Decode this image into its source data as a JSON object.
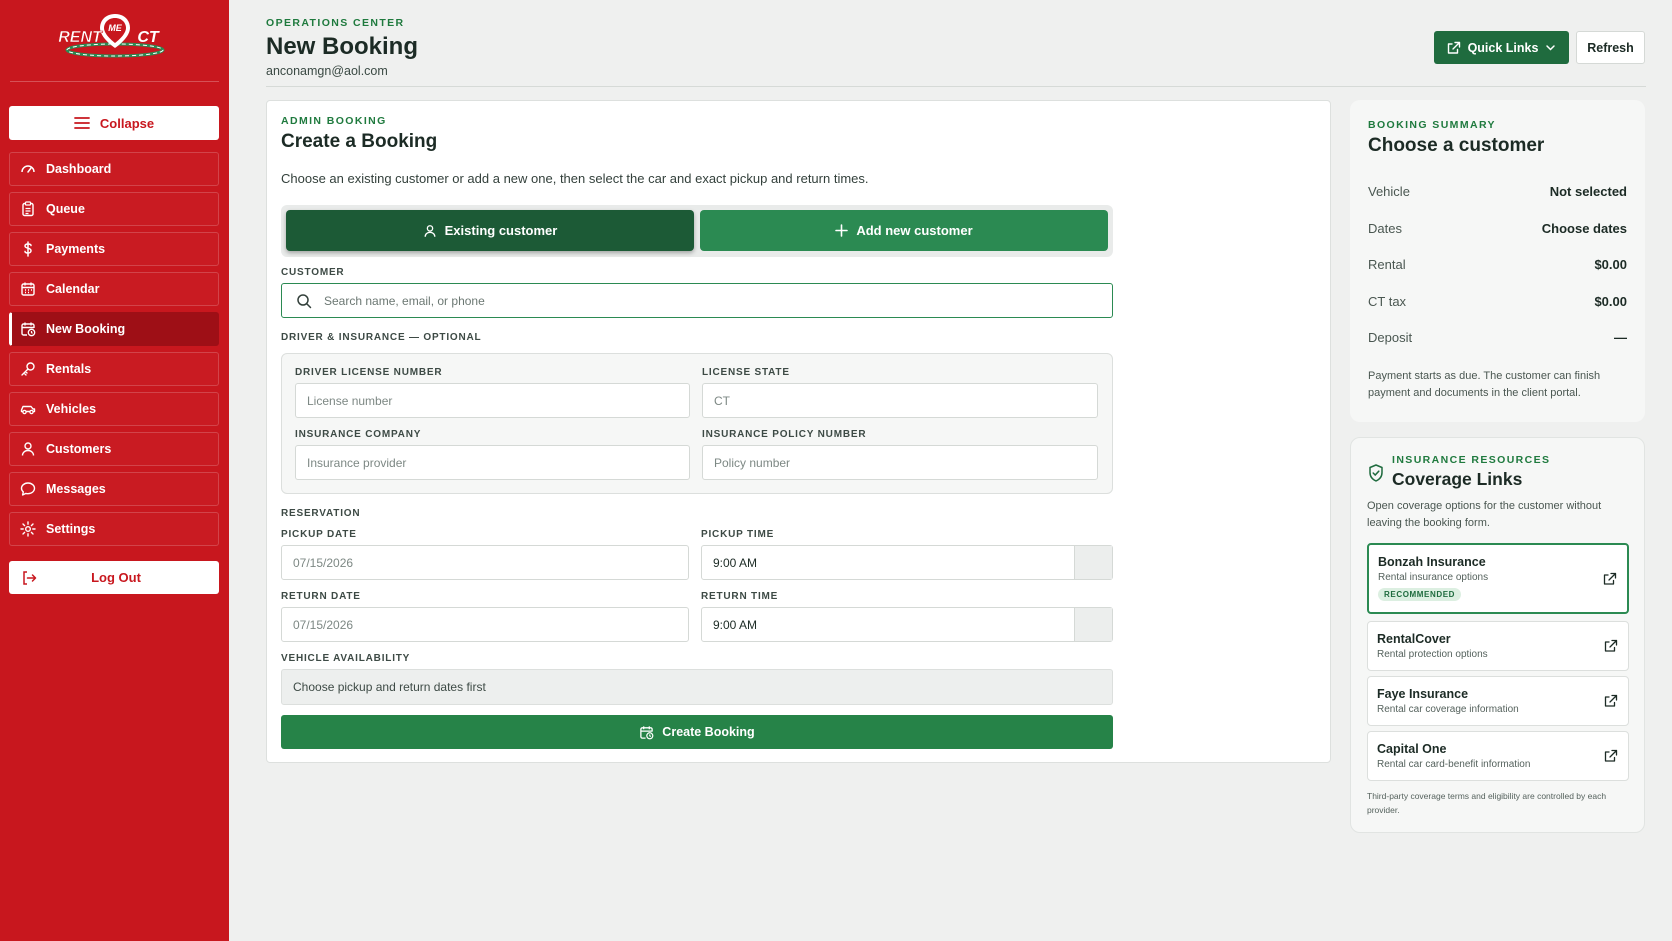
{
  "brand": {
    "logo_text": "RENT ME CT",
    "primary_color": "#c8171e",
    "accent_color": "#1f6b3e"
  },
  "sidebar": {
    "collapse_label": "Collapse",
    "items": [
      {
        "label": "Dashboard",
        "icon": "gauge-icon",
        "active": false
      },
      {
        "label": "Queue",
        "icon": "clipboard-icon",
        "active": false
      },
      {
        "label": "Payments",
        "icon": "dollar-icon",
        "active": false
      },
      {
        "label": "Calendar",
        "icon": "calendar-icon",
        "active": false
      },
      {
        "label": "New Booking",
        "icon": "calendar-clock-icon",
        "active": true
      },
      {
        "label": "Rentals",
        "icon": "key-icon",
        "active": false
      },
      {
        "label": "Vehicles",
        "icon": "car-icon",
        "active": false
      },
      {
        "label": "Customers",
        "icon": "user-icon",
        "active": false
      },
      {
        "label": "Messages",
        "icon": "chat-icon",
        "active": false
      },
      {
        "label": "Settings",
        "icon": "gear-icon",
        "active": false
      }
    ],
    "logout_label": "Log Out"
  },
  "header": {
    "eyebrow": "OPERATIONS CENTER",
    "title": "New Booking",
    "email": "anconamgn@aol.com",
    "quick_links_label": "Quick Links",
    "refresh_label": "Refresh"
  },
  "booking": {
    "eyebrow": "ADMIN BOOKING",
    "title": "Create a Booking",
    "description": "Choose an existing customer or add a new one, then select the car and exact pickup and return times.",
    "existing_customer_label": "Existing customer",
    "add_customer_label": "Add new customer",
    "customer_label": "CUSTOMER",
    "customer_placeholder": "Search name, email, or phone",
    "driver_section_label": "DRIVER & INSURANCE — OPTIONAL",
    "license_number_label": "DRIVER LICENSE NUMBER",
    "license_number_placeholder": "License number",
    "license_state_label": "LICENSE STATE",
    "license_state_placeholder": "CT",
    "insurance_company_label": "INSURANCE COMPANY",
    "insurance_company_placeholder": "Insurance provider",
    "policy_number_label": "INSURANCE POLICY NUMBER",
    "policy_number_placeholder": "Policy number",
    "reservation_label": "RESERVATION",
    "pickup_date_label": "PICKUP DATE",
    "pickup_date_value": "07/15/2026",
    "pickup_time_label": "PICKUP TIME",
    "pickup_time_value": "9:00 AM",
    "return_date_label": "RETURN DATE",
    "return_date_value": "07/15/2026",
    "return_time_label": "RETURN TIME",
    "return_time_value": "9:00 AM",
    "availability_label": "VEHICLE AVAILABILITY",
    "availability_text": "Choose pickup and return dates first",
    "create_label": "Create Booking"
  },
  "summary": {
    "eyebrow": "BOOKING SUMMARY",
    "title": "Choose a customer",
    "rows": [
      {
        "key": "Vehicle",
        "value": "Not selected"
      },
      {
        "key": "Dates",
        "value": "Choose dates"
      },
      {
        "key": "Rental",
        "value": "$0.00"
      },
      {
        "key": "CT tax",
        "value": "$0.00"
      },
      {
        "key": "Deposit",
        "value": "—"
      }
    ],
    "note": "Payment starts as due. The customer can finish payment and documents in the client portal."
  },
  "insurance": {
    "eyebrow": "INSURANCE RESOURCES",
    "title": "Coverage Links",
    "description": "Open coverage options for the customer without leaving the booking form.",
    "providers": [
      {
        "name": "Bonzah Insurance",
        "subtitle": "Rental insurance options",
        "badge": "RECOMMENDED"
      },
      {
        "name": "RentalCover",
        "subtitle": "Rental protection options"
      },
      {
        "name": "Faye Insurance",
        "subtitle": "Rental car coverage information"
      },
      {
        "name": "Capital One",
        "subtitle": "Rental car card-benefit information"
      }
    ],
    "footer": "Third-party coverage terms and eligibility are controlled by each provider."
  }
}
